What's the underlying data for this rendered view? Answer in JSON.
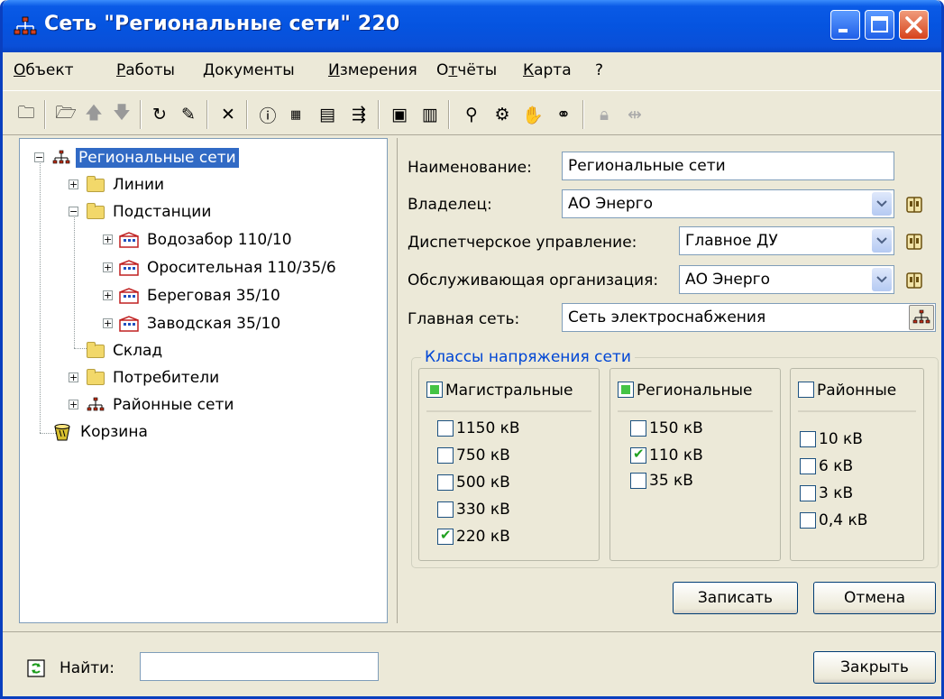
{
  "window": {
    "title": "Сеть \"Региональные сети\" 220"
  },
  "menu": [
    {
      "label": "Объект",
      "u": "О"
    },
    {
      "label": "Работы",
      "u": "Р"
    },
    {
      "label": "Документы",
      "u": "Д"
    },
    {
      "label": "Измерения",
      "u": "И"
    },
    {
      "label": "Отчёты",
      "u": "т"
    },
    {
      "label": "Карта",
      "u": "К"
    },
    {
      "label": "?",
      "u": ""
    }
  ],
  "toolbar": {
    "icons": [
      "new-object-icon",
      "open-folder-icon",
      "move-up-icon",
      "move-down-icon",
      "refresh-icon",
      "edit-icon",
      "delete-icon",
      "info-icon",
      "measurements-icon",
      "report-icon",
      "export-icon",
      "document-icon",
      "list-icon",
      "wand-icon",
      "search-network-icon",
      "hand-icon",
      "link-icon",
      "lock-icon",
      "disconnect-icon"
    ]
  },
  "tree": {
    "nodes": [
      {
        "label": "Региональные сети"
      },
      {
        "label": "Линии"
      },
      {
        "label": "Подстанции"
      },
      {
        "label": "Водозабор 110/10"
      },
      {
        "label": "Оросительная 110/35/6"
      },
      {
        "label": "Береговая 35/10"
      },
      {
        "label": "Заводская 35/10"
      },
      {
        "label": "Склад"
      },
      {
        "label": "Потребители"
      },
      {
        "label": "Районные сети"
      },
      {
        "label": "Корзина"
      }
    ]
  },
  "form": {
    "name_label": "Наименование:",
    "name_value": "Региональные сети",
    "owner_label": "Владелец:",
    "owner_value": "АО Энерго",
    "dispatch_label": "Диспетчерское управление:",
    "dispatch_value": "Главное ДУ",
    "service_label": "Обслуживающая организация:",
    "service_value": "АО Энерго",
    "main_net_label": "Главная сеть:",
    "main_net_value": "Сеть электроснабжения"
  },
  "voltage": {
    "title": "Классы напряжения сети",
    "groups": [
      {
        "name": "Магистральные",
        "items": [
          {
            "label": "1150 кВ"
          },
          {
            "label": "750 кВ"
          },
          {
            "label": "500 кВ"
          },
          {
            "label": "330 кВ"
          },
          {
            "label": "220 кВ"
          }
        ]
      },
      {
        "name": "Региональные",
        "items": [
          {
            "label": "150 кВ"
          },
          {
            "label": "110 кВ"
          },
          {
            "label": "35 кВ"
          }
        ]
      },
      {
        "name": "Районные",
        "items": [
          {
            "label": "10 кВ"
          },
          {
            "label": "6 кВ"
          },
          {
            "label": "3 кВ"
          },
          {
            "label": "0,4 кВ"
          }
        ]
      }
    ]
  },
  "buttons": {
    "save": "Записать",
    "cancel": "Отмена",
    "close": "Закрыть"
  },
  "search": {
    "label": "Найти:",
    "value": ""
  }
}
